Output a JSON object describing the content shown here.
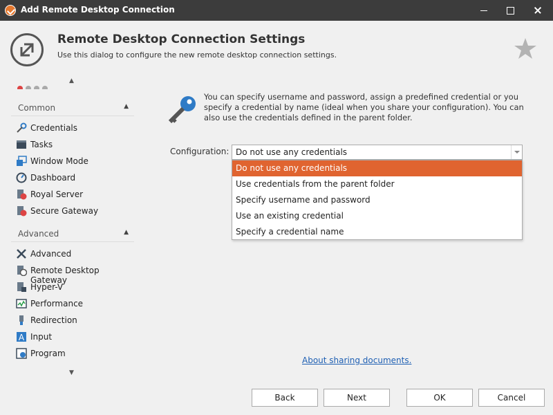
{
  "window": {
    "title": "Add Remote Desktop Connection"
  },
  "header": {
    "title": "Remote Desktop Connection Settings",
    "subtitle": "Use this dialog to configure the new remote desktop connection settings."
  },
  "sidebar": {
    "groups": [
      {
        "label": "Common",
        "items": [
          {
            "label": "Credentials",
            "icon": "key-icon"
          },
          {
            "label": "Tasks",
            "icon": "tasks-icon"
          },
          {
            "label": "Window Mode",
            "icon": "window-mode-icon"
          },
          {
            "label": "Dashboard",
            "icon": "dashboard-icon"
          },
          {
            "label": "Royal Server",
            "icon": "royal-server-icon"
          },
          {
            "label": "Secure Gateway",
            "icon": "secure-gateway-icon"
          }
        ]
      },
      {
        "label": "Advanced",
        "items": [
          {
            "label": "Advanced",
            "icon": "tools-icon"
          },
          {
            "label": "Remote Desktop Gateway",
            "icon": "gateway-icon"
          },
          {
            "label": "Hyper-V",
            "icon": "hyperv-icon"
          },
          {
            "label": "Performance",
            "icon": "performance-icon"
          },
          {
            "label": "Redirection",
            "icon": "redirection-icon"
          },
          {
            "label": "Input",
            "icon": "input-icon"
          },
          {
            "label": "Program",
            "icon": "program-icon"
          }
        ]
      }
    ]
  },
  "content": {
    "info": "You can specify username and password, assign a predefined credential or you specify a credential by name (ideal when you share your configuration). You can also use the credentials defined in the parent folder.",
    "config_label": "Configuration:",
    "config_value": "Do not use any credentials",
    "options": [
      "Do not use any credentials",
      "Use credentials from the parent folder",
      "Specify username and password",
      "Use an existing credential",
      "Specify a credential name"
    ],
    "link": "About sharing documents."
  },
  "buttons": {
    "back": "Back",
    "next": "Next",
    "ok": "OK",
    "cancel": "Cancel"
  },
  "colors": {
    "titlebar": "#3c3c3c",
    "selected": "#e06430",
    "link": "#1e5fb3",
    "accent_blue": "#2f7bc6"
  }
}
